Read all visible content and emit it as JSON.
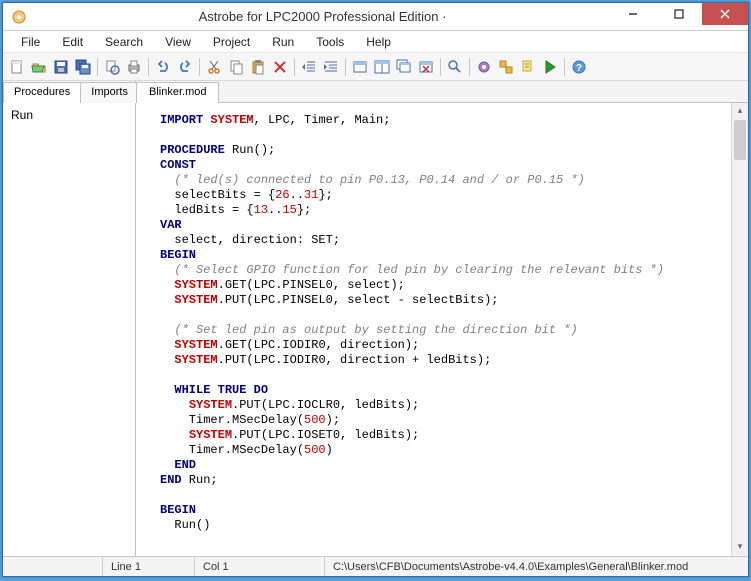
{
  "window": {
    "title": "Astrobe for LPC2000 Professional Edition  ·"
  },
  "menu": {
    "items": [
      "File",
      "Edit",
      "Search",
      "View",
      "Project",
      "Run",
      "Tools",
      "Help"
    ]
  },
  "toolbar_icons": [
    "new-file",
    "open-folder",
    "save",
    "save-all",
    "separator",
    "print-preview",
    "print",
    "separator",
    "undo",
    "redo",
    "separator",
    "cut",
    "copy",
    "paste",
    "delete",
    "separator",
    "outdent",
    "indent",
    "separator",
    "window-new",
    "window-tile",
    "window-cascade",
    "window-close",
    "separator",
    "find",
    "separator",
    "gear",
    "build",
    "link",
    "run",
    "separator",
    "help"
  ],
  "left_panel": {
    "tabs": [
      "Procedures",
      "Imports"
    ],
    "active_tab": 0,
    "items": [
      "Run"
    ]
  },
  "editor": {
    "tab_label": "Blinker.mod",
    "code": [
      {
        "indent": 0,
        "parts": [
          {
            "t": "kw",
            "v": "IMPORT"
          },
          {
            "t": "sp"
          },
          {
            "t": "sys",
            "v": "SYSTEM"
          },
          {
            "t": "pl",
            "v": ", LPC, Timer, Main;"
          }
        ]
      },
      {
        "blank": true
      },
      {
        "indent": 0,
        "parts": [
          {
            "t": "kw",
            "v": "PROCEDURE"
          },
          {
            "t": "pl",
            "v": " Run();"
          }
        ]
      },
      {
        "indent": 0,
        "parts": [
          {
            "t": "kw",
            "v": "CONST"
          }
        ]
      },
      {
        "indent": 1,
        "parts": [
          {
            "t": "cm",
            "v": "(* led(s) connected to pin P0.13, P0.14 and / or P0.15 *)"
          }
        ]
      },
      {
        "indent": 1,
        "parts": [
          {
            "t": "pl",
            "v": "selectBits = {"
          },
          {
            "t": "num",
            "v": "26"
          },
          {
            "t": "pl",
            "v": ".."
          },
          {
            "t": "num",
            "v": "31"
          },
          {
            "t": "pl",
            "v": "};"
          }
        ]
      },
      {
        "indent": 1,
        "parts": [
          {
            "t": "pl",
            "v": "ledBits = {"
          },
          {
            "t": "num",
            "v": "13"
          },
          {
            "t": "pl",
            "v": ".."
          },
          {
            "t": "num",
            "v": "15"
          },
          {
            "t": "pl",
            "v": "};"
          }
        ]
      },
      {
        "indent": 0,
        "parts": [
          {
            "t": "kw",
            "v": "VAR"
          }
        ]
      },
      {
        "indent": 1,
        "parts": [
          {
            "t": "pl",
            "v": "select, direction: SET;"
          }
        ]
      },
      {
        "indent": 0,
        "parts": [
          {
            "t": "kw",
            "v": "BEGIN"
          }
        ]
      },
      {
        "indent": 1,
        "parts": [
          {
            "t": "cm",
            "v": "(* Select GPIO function for led pin by clearing the relevant bits *)"
          }
        ]
      },
      {
        "indent": 1,
        "parts": [
          {
            "t": "sys",
            "v": "SYSTEM"
          },
          {
            "t": "pl",
            "v": ".GET(LPC.PINSEL0, select);"
          }
        ]
      },
      {
        "indent": 1,
        "parts": [
          {
            "t": "sys",
            "v": "SYSTEM"
          },
          {
            "t": "pl",
            "v": ".PUT(LPC.PINSEL0, select - selectBits);"
          }
        ]
      },
      {
        "blank": true
      },
      {
        "indent": 1,
        "parts": [
          {
            "t": "cm",
            "v": "(* Set led pin as output by setting the direction bit *)"
          }
        ]
      },
      {
        "indent": 1,
        "parts": [
          {
            "t": "sys",
            "v": "SYSTEM"
          },
          {
            "t": "pl",
            "v": ".GET(LPC.IODIR0, direction);"
          }
        ]
      },
      {
        "indent": 1,
        "parts": [
          {
            "t": "sys",
            "v": "SYSTEM"
          },
          {
            "t": "pl",
            "v": ".PUT(LPC.IODIR0, direction + ledBits);"
          }
        ]
      },
      {
        "blank": true
      },
      {
        "indent": 1,
        "parts": [
          {
            "t": "kw",
            "v": "WHILE"
          },
          {
            "t": "pl",
            "v": " "
          },
          {
            "t": "kw",
            "v": "TRUE"
          },
          {
            "t": "pl",
            "v": " "
          },
          {
            "t": "kw",
            "v": "DO"
          }
        ]
      },
      {
        "indent": 2,
        "parts": [
          {
            "t": "sys",
            "v": "SYSTEM"
          },
          {
            "t": "pl",
            "v": ".PUT(LPC.IOCLR0, ledBits);"
          }
        ]
      },
      {
        "indent": 2,
        "parts": [
          {
            "t": "pl",
            "v": "Timer.MSecDelay("
          },
          {
            "t": "num",
            "v": "500"
          },
          {
            "t": "pl",
            "v": ");"
          }
        ]
      },
      {
        "indent": 2,
        "parts": [
          {
            "t": "sys",
            "v": "SYSTEM"
          },
          {
            "t": "pl",
            "v": ".PUT(LPC.IOSET0, ledBits);"
          }
        ]
      },
      {
        "indent": 2,
        "parts": [
          {
            "t": "pl",
            "v": "Timer.MSecDelay("
          },
          {
            "t": "num",
            "v": "500"
          },
          {
            "t": "pl",
            "v": ")"
          }
        ]
      },
      {
        "indent": 1,
        "parts": [
          {
            "t": "kw",
            "v": "END"
          }
        ]
      },
      {
        "indent": 0,
        "parts": [
          {
            "t": "kw",
            "v": "END"
          },
          {
            "t": "pl",
            "v": " Run;"
          }
        ]
      },
      {
        "blank": true
      },
      {
        "indent": 0,
        "parts": [
          {
            "t": "kw",
            "v": "BEGIN"
          }
        ]
      },
      {
        "indent": 1,
        "parts": [
          {
            "t": "pl",
            "v": "Run()"
          }
        ]
      }
    ]
  },
  "status": {
    "line": "Line 1",
    "col": "Col 1",
    "path": "C:\\Users\\CFB\\Documents\\Astrobe-v4.4.0\\Examples\\General\\Blinker.mod"
  }
}
